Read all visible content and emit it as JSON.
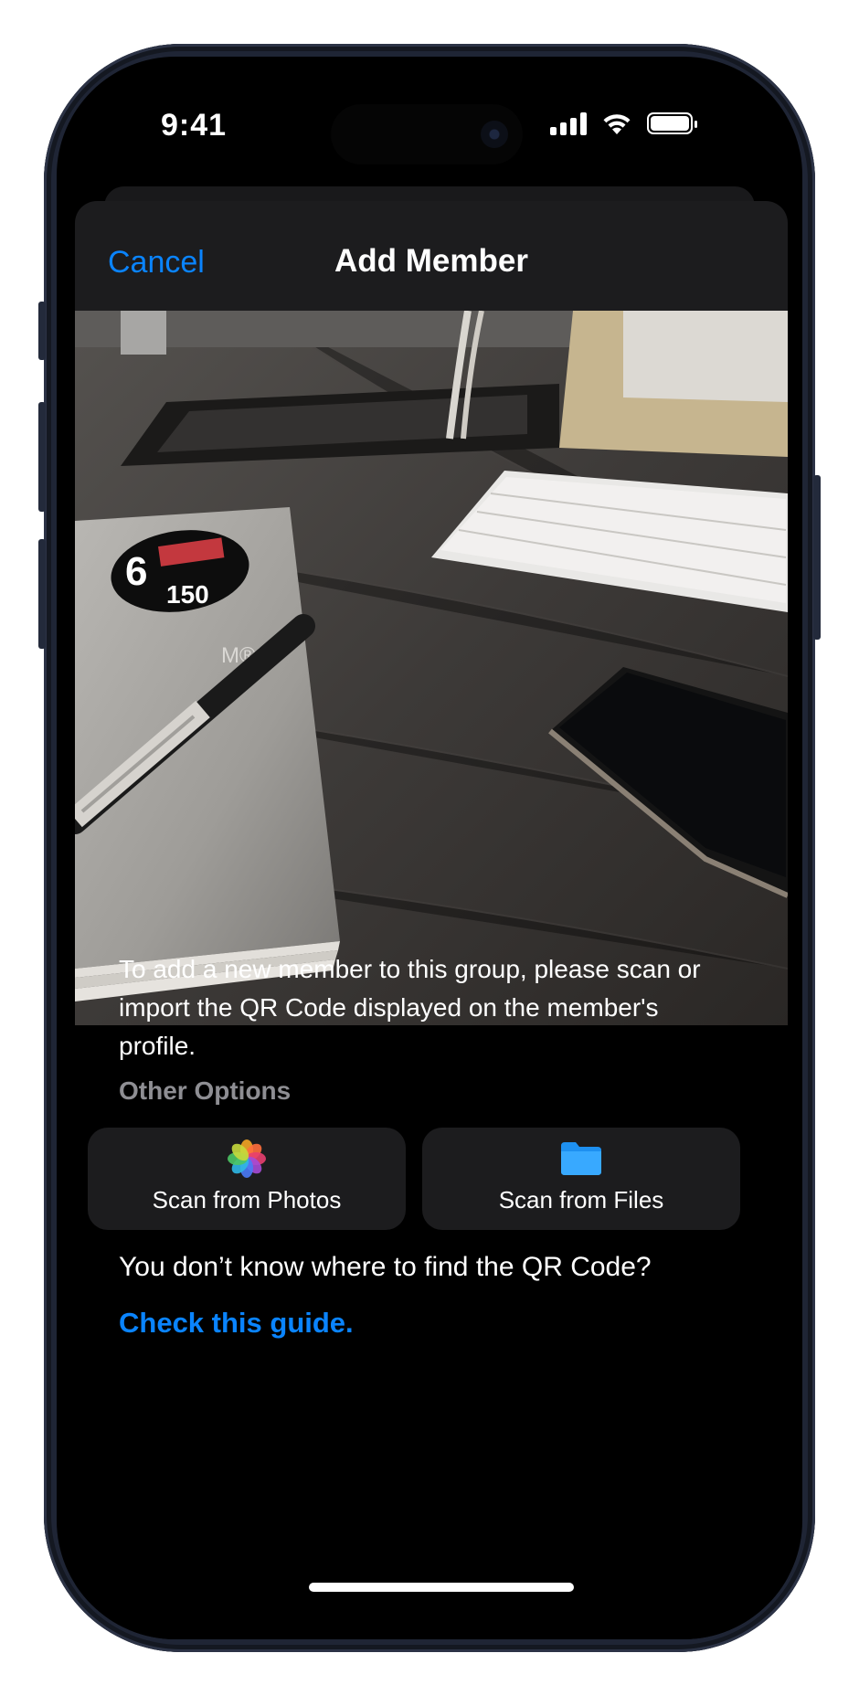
{
  "status_bar": {
    "time": "9:41"
  },
  "nav": {
    "cancel_label": "Cancel",
    "title": "Add Member"
  },
  "description": "To add a new member to this group, please scan or import the QR Code displayed on the member's profile.",
  "other_options": {
    "label": "Other Options",
    "photos_label": "Scan from Photos",
    "files_label": "Scan from Files"
  },
  "help": {
    "question": "You don’t know where to find the QR Code?",
    "link": "Check this guide."
  },
  "preview": {
    "sticker_top": "6",
    "sticker_bottom": "150",
    "book_mark": "M®6"
  },
  "colors": {
    "accent": "#0a84ff",
    "background": "#000000",
    "surface": "#1c1c1e",
    "secondary_text": "#8e8e93"
  },
  "icons": [
    "wifi-icon",
    "cellular-signal-icon",
    "battery-icon",
    "photos-app-icon",
    "folder-icon"
  ]
}
